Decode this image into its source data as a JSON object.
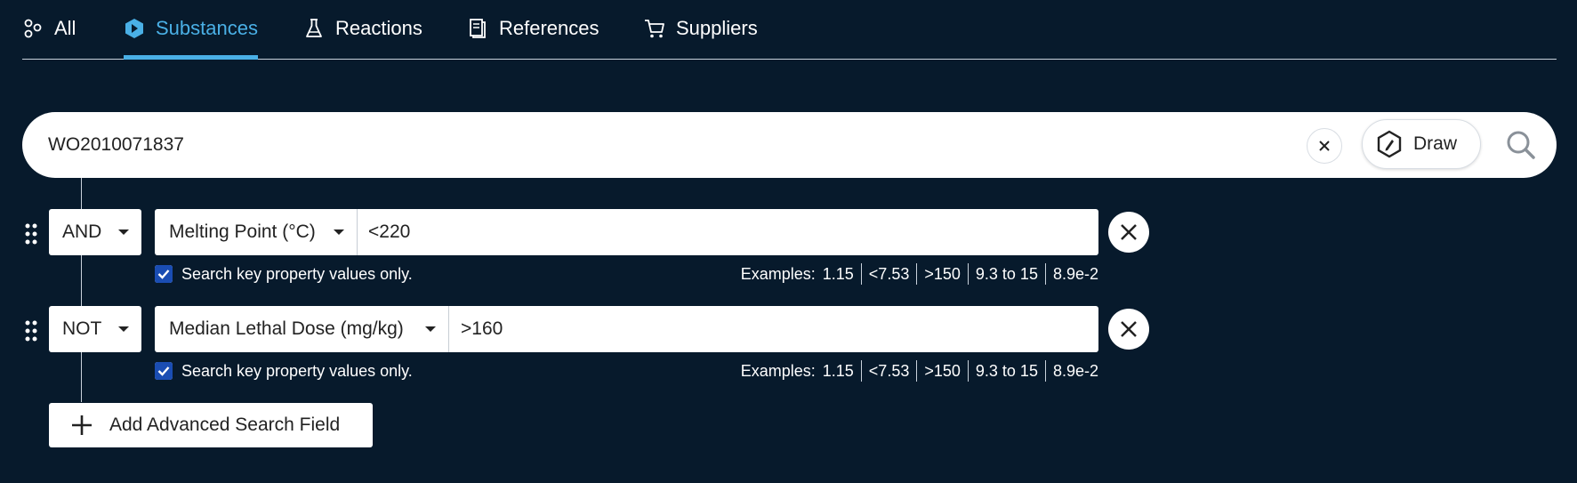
{
  "tabs": [
    {
      "label": "All",
      "icon": "all-icon",
      "active": false
    },
    {
      "label": "Substances",
      "icon": "substance-hexagon-icon",
      "active": true
    },
    {
      "label": "Reactions",
      "icon": "flask-icon",
      "active": false
    },
    {
      "label": "References",
      "icon": "document-icon",
      "active": false
    },
    {
      "label": "Suppliers",
      "icon": "cart-icon",
      "active": false
    }
  ],
  "search": {
    "value": "WO2010071837",
    "draw_label": "Draw"
  },
  "rows": [
    {
      "operator": "AND",
      "property": "Melting Point (°C)",
      "value": "<220",
      "checkbox_label": "Search key property values only.",
      "checked": true,
      "examples_label": "Examples:",
      "examples": [
        "1.15",
        "<7.53",
        ">150",
        "9.3 to 15",
        "8.9e-2"
      ]
    },
    {
      "operator": "NOT",
      "property": "Median Lethal Dose (mg/kg)",
      "value": ">160",
      "checkbox_label": "Search key property values only.",
      "checked": true,
      "examples_label": "Examples:",
      "examples": [
        "1.15",
        "<7.53",
        ">150",
        "9.3 to 15",
        "8.9e-2"
      ]
    }
  ],
  "add_field_label": "Add Advanced Search Field",
  "colors": {
    "background": "#071a2c",
    "accent": "#4ab0e6",
    "checkbox": "#1a4db3"
  }
}
